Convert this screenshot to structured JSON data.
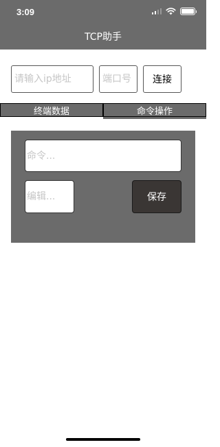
{
  "status_bar": {
    "time": "3:09"
  },
  "nav": {
    "title": "TCP助手"
  },
  "connection": {
    "ip_placeholder": "请输入ip地址",
    "ip_value": "",
    "port_placeholder": "端口号",
    "port_value": "",
    "connect_label": "连接"
  },
  "tabs": [
    {
      "label": "终端数据",
      "selected": false
    },
    {
      "label": "命令操作",
      "selected": true
    }
  ],
  "command_panel": {
    "command_placeholder": "命令...",
    "command_value": "",
    "edit_placeholder": "编辑...",
    "edit_value": "",
    "save_label": "保存"
  },
  "colors": {
    "header_bg": "#6b6b6b",
    "panel_bg": "#6b6b6b",
    "save_button_bg": "#3a3634",
    "placeholder": "#c6c6c6"
  }
}
